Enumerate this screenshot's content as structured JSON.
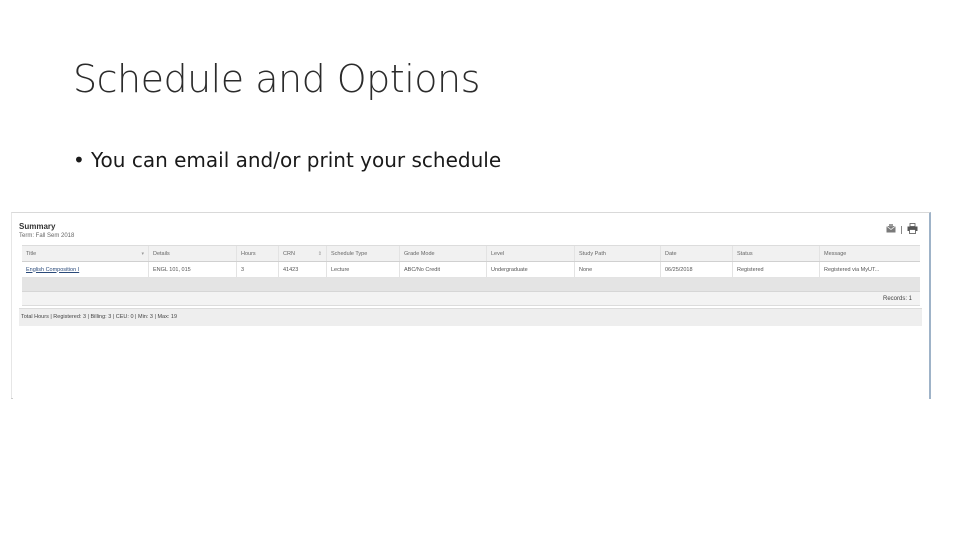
{
  "slide": {
    "title": "Schedule and Options",
    "bullet": "You can email and/or print your schedule"
  },
  "summary": {
    "heading": "Summary",
    "term": "Term: Fall Sem 2018",
    "toolbar_separator": "|",
    "icons": {
      "email": "email-icon",
      "print": "print-icon",
      "settings": "gear-icon"
    },
    "columns": [
      "Title",
      "Details",
      "Hours",
      "CRN",
      "Schedule Type",
      "Grade Mode",
      "Level",
      "Study Path",
      "Date",
      "Status",
      "Message"
    ],
    "rows": [
      {
        "title": "English Composition I",
        "details": "ENGL 101, 015",
        "hours": "3",
        "crn": "41423",
        "schedule_type": "Lecture",
        "grade_mode": "ABC/No Credit",
        "level": "Undergraduate",
        "study_path": "None",
        "date": "06/25/2018",
        "status": "Registered",
        "message": "Registered via MyUT..."
      }
    ],
    "records": "Records: 1",
    "totals": "Total Hours | Registered: 3 | Billing: 3 | CEU: 0 | Min: 3 | Max: 19"
  }
}
